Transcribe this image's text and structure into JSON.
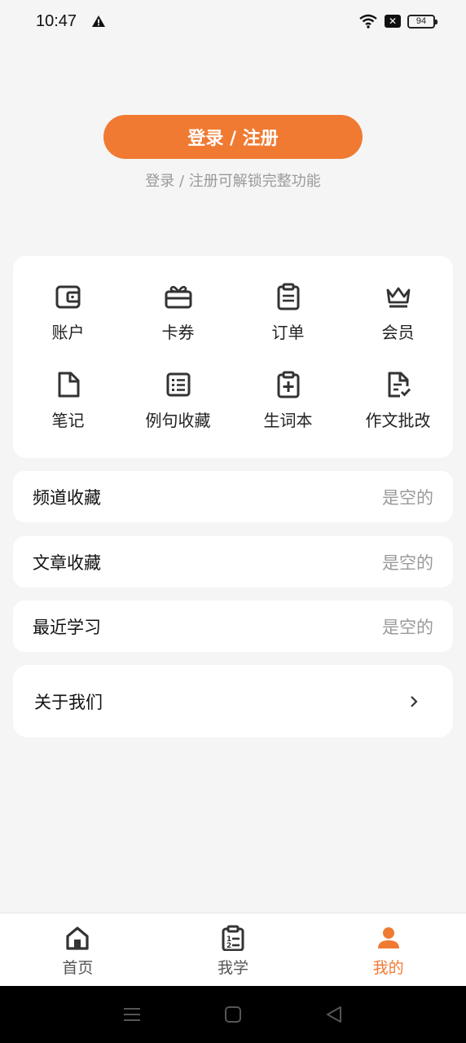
{
  "status_bar": {
    "time": "10:47",
    "battery": "94"
  },
  "login": {
    "button_label": "登录 / 注册",
    "hint": "登录 / 注册可解锁完整功能"
  },
  "grid": {
    "items": [
      {
        "label": "账户",
        "icon": "wallet-icon"
      },
      {
        "label": "卡券",
        "icon": "gift-card-icon"
      },
      {
        "label": "订单",
        "icon": "clipboard-icon"
      },
      {
        "label": "会员",
        "icon": "crown-icon"
      },
      {
        "label": "笔记",
        "icon": "note-icon"
      },
      {
        "label": "例句收藏",
        "icon": "list-icon"
      },
      {
        "label": "生词本",
        "icon": "clipboard-plus-icon"
      },
      {
        "label": "作文批改",
        "icon": "document-check-icon"
      }
    ]
  },
  "lists": [
    {
      "title": "频道收藏",
      "value": "是空的"
    },
    {
      "title": "文章收藏",
      "value": "是空的"
    },
    {
      "title": "最近学习",
      "value": "是空的"
    }
  ],
  "about": {
    "title": "关于我们"
  },
  "bottom_nav": {
    "items": [
      {
        "label": "首页",
        "icon": "home-icon",
        "active": false
      },
      {
        "label": "我学",
        "icon": "study-clipboard-icon",
        "active": false
      },
      {
        "label": "我的",
        "icon": "person-icon",
        "active": true
      }
    ]
  },
  "colors": {
    "accent": "#f07a32",
    "background": "#f5f5f5",
    "muted_text": "#9a9a9a"
  }
}
